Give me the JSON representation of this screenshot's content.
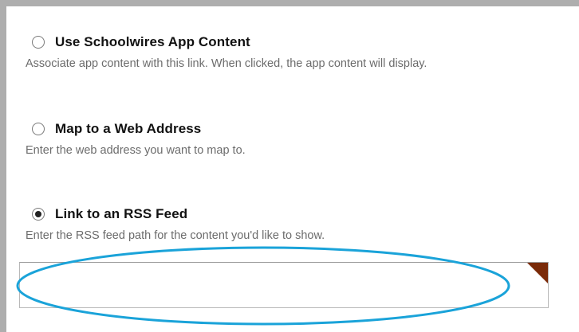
{
  "options": [
    {
      "title": "Use Schoolwires App Content",
      "description": "Associate app content with this link. When clicked, the app content will display.",
      "selected": false
    },
    {
      "title": "Map to a Web Address",
      "description": "Enter the web address you want to map to.",
      "selected": false
    },
    {
      "title": "Link to an RSS Feed",
      "description": "Enter the RSS feed path for the content you'd like to show.",
      "selected": true
    }
  ],
  "rss_input": {
    "value": "",
    "placeholder": ""
  },
  "colors": {
    "frame_border": "#aeaeae",
    "highlight": "#1aa3d9",
    "corner_mark": "#7a2a08",
    "description_text": "#6c6c6c"
  }
}
